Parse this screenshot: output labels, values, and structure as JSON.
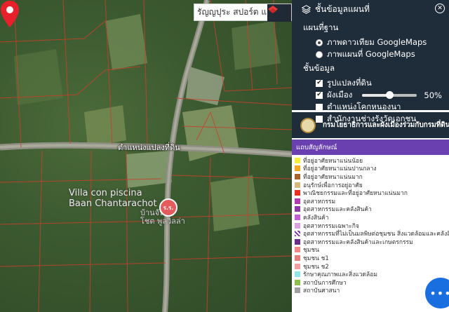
{
  "search": {
    "value": "รัญญปุระ สปอร์ต แ"
  },
  "map": {
    "marker_label": "ตำแหน่งแปลงที่ดิน",
    "place_name_1": "Villa con piscina",
    "place_name_2": "Baan Chantarachot",
    "place_sub_1": "บ้านจันท",
    "place_sub_2": "โชต พูลวิลล่า",
    "poi_text": "ร.ร."
  },
  "panel": {
    "title": "ชั้นข้อมูลแผนที่",
    "basemap_title": "แผนที่ฐาน",
    "basemap_options": [
      "ภาพดาวเทียม GoogleMaps",
      "ภาพแผนที่ GoogleMaps"
    ],
    "basemap_selected": 0,
    "layers_title": "ชั้นข้อมูล",
    "layers": [
      {
        "label": "รูปแปลงที่ดิน",
        "checked": true
      },
      {
        "label": "ผังเมือง",
        "checked": true,
        "opacity_percent": 50,
        "opacity_label": "50%"
      },
      {
        "label": "ตำแหน่งโคกหนองนา",
        "checked": false
      },
      {
        "label": "สำนักงานช่างรังวัดเอกชน",
        "checked": false
      }
    ],
    "dept_name": "กรมโยธาธิการและผังเมืองร่วมกับกรมที่ดิน",
    "legend_title": "แถบสัญลักษณ์",
    "legend": [
      {
        "label": "ที่อยู่อาศัยหนาแน่นน้อย",
        "color": "#f7ef3a"
      },
      {
        "label": "ที่อยู่อาศัยหนาแน่นปานกลาง",
        "color": "#f5a623"
      },
      {
        "label": "ที่อยู่อาศัยหนาแน่นมาก",
        "color": "#a5652a"
      },
      {
        "label": "อนุรักษ์เพื่อการอยู่อาศัย",
        "color": "#d9b97a"
      },
      {
        "label": "พาณิชยกรรมและที่อยู่อาศัยหนาแน่นมาก",
        "color": "#e8321f"
      },
      {
        "label": "อุตสาหกรรม",
        "color": "#b23bb0"
      },
      {
        "label": "อุตสาหกรรมและคลังสินค้า",
        "color": "#8c3aa8"
      },
      {
        "label": "คลังสินค้า",
        "color": "#c05fd4"
      },
      {
        "label": "อุตสาหกรรมเฉพาะกิจ",
        "color": "#d9a3e0"
      },
      {
        "label": "อุตสาหกรรมที่ไม่เป็นมลพิษต่อชุมชน สิ่งแวดล้อมและคลังสินค้า",
        "color": "#7a2aa0"
      },
      {
        "label": "อุตสาหกรรมและคลังสินค้าและเกษตรกรรม",
        "color": "#6a2f8a"
      },
      {
        "label": "ชุมชน",
        "color": "#f08a8a"
      },
      {
        "label": "ชุมชน ช1",
        "color": "#e77c7c"
      },
      {
        "label": "ชุมชน ช2",
        "color": "#f0a0a0"
      },
      {
        "label": "รักษาคุณภาพและสิ่งแวดล้อม",
        "color": "#8fe6e8"
      },
      {
        "label": "สถาบันการศึกษา",
        "color": "#8cc04a"
      },
      {
        "label": "สถาบันศาสนา",
        "color": "#a0a0a0"
      }
    ]
  },
  "fab": {
    "label": "•••"
  }
}
